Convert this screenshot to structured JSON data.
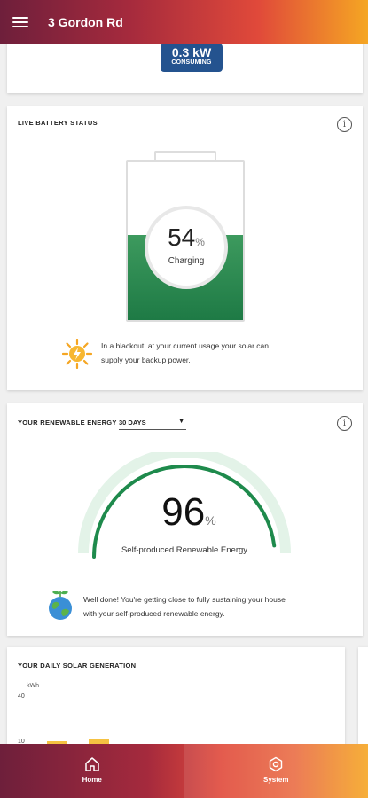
{
  "header": {
    "title": "3 Gordon Rd"
  },
  "consumption": {
    "value": "0.3 kW",
    "label": "CONSUMING"
  },
  "battery": {
    "title": "LIVE BATTERY STATUS",
    "percent": "54",
    "percent_sign": "%",
    "status": "Charging",
    "level_fraction": 0.54,
    "message_line1": "In a blackout, at your current usage your solar can",
    "message_line2": "supply your backup power.",
    "message_icon": "sun-bolt-icon",
    "fill_color": "#2a8a4f"
  },
  "renewable": {
    "title": "YOUR RENEWABLE ENERGY",
    "period": "30 DAYS",
    "value": "96",
    "percent_sign": "%",
    "gauge_fraction": 0.96,
    "label": "Self-produced Renewable Energy",
    "message_line1": "Well done! You're getting close to fully sustaining your house",
    "message_line2": "with your self-produced renewable energy.",
    "message_icon": "globe-sprout-icon",
    "gauge_color": "#1e8a4c",
    "track_color": "#e3f3e8"
  },
  "solar": {
    "title": "YOUR DAILY SOLAR GENERATION",
    "unit": "kWh",
    "ticks": [
      "40",
      "10"
    ],
    "bar_values": [
      10,
      12
    ],
    "bar_color": "#f5c242"
  },
  "bottom_nav": {
    "home_label": "Home",
    "system_label": "System"
  }
}
